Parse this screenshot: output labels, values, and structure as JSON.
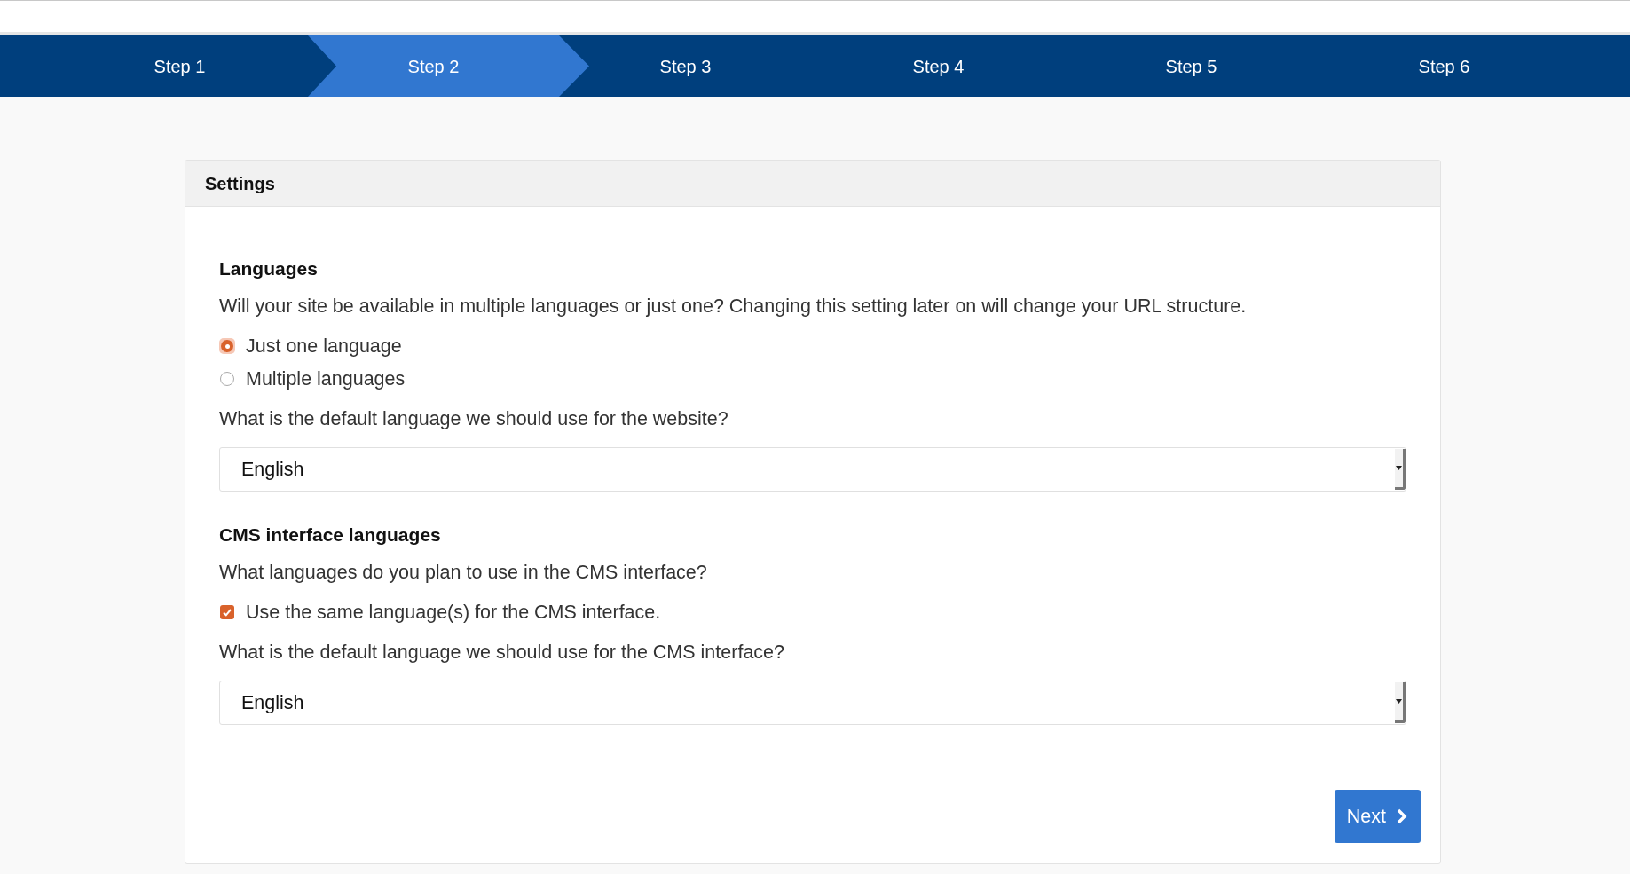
{
  "steps": [
    {
      "label": "Step 1",
      "selected": false
    },
    {
      "label": "Step 2",
      "selected": true
    },
    {
      "label": "Step 3",
      "selected": false
    },
    {
      "label": "Step 4",
      "selected": false
    },
    {
      "label": "Step 5",
      "selected": false
    },
    {
      "label": "Step 6",
      "selected": false
    }
  ],
  "panel": {
    "title": "Settings"
  },
  "sections": [
    {
      "heading": "Languages",
      "description": "Will your site be available in multiple languages or just one? Changing this setting later on will change your URL structure.",
      "options": [
        {
          "kind": "radio",
          "label": "Just one language",
          "checked": true
        },
        {
          "kind": "radio",
          "label": "Multiple languages",
          "checked": false
        }
      ],
      "question": "What is the default language we should use for the website?",
      "select": {
        "value": "English"
      }
    },
    {
      "heading": "CMS interface languages",
      "description": "What languages do you plan to use in the CMS interface?",
      "options": [
        {
          "kind": "checkbox",
          "label": "Use the same language(s) for the CMS interface.",
          "checked": true
        }
      ],
      "question": "What is the default language we should use for the CMS interface?",
      "select": {
        "value": "English"
      }
    }
  ],
  "next_button": {
    "label": "Next"
  }
}
